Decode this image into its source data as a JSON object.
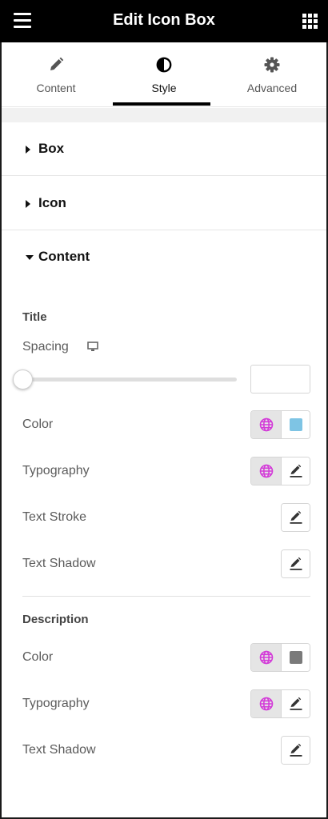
{
  "header": {
    "title": "Edit Icon Box",
    "menu_icon": "hamburger-icon",
    "apps_icon": "grid-icon"
  },
  "tabs": [
    {
      "label": "Content",
      "icon": "pencil-icon",
      "active": false
    },
    {
      "label": "Style",
      "icon": "contrast-icon",
      "active": true
    },
    {
      "label": "Advanced",
      "icon": "gear-icon",
      "active": false
    }
  ],
  "sections": {
    "box": {
      "title": "Box",
      "expanded": false
    },
    "icon": {
      "title": "Icon",
      "expanded": false
    },
    "content": {
      "title": "Content",
      "expanded": true
    }
  },
  "title_group": {
    "heading": "Title",
    "spacing": {
      "label": "Spacing",
      "value": "",
      "device_icon": "desktop-icon",
      "slider_level": 0
    },
    "color": {
      "label": "Color",
      "swatch": "#7ec4e4",
      "global_icon": "globe-icon"
    },
    "typography": {
      "label": "Typography",
      "global_icon": "globe-icon",
      "edit_icon": "pencil-icon"
    },
    "text_stroke": {
      "label": "Text Stroke",
      "edit_icon": "pencil-icon"
    },
    "text_shadow": {
      "label": "Text Shadow",
      "edit_icon": "pencil-icon"
    }
  },
  "description_group": {
    "heading": "Description",
    "color": {
      "label": "Color",
      "swatch": "#7a7a7a",
      "global_icon": "globe-icon"
    },
    "typography": {
      "label": "Typography",
      "global_icon": "globe-icon",
      "edit_icon": "pencil-icon"
    },
    "text_shadow": {
      "label": "Text Shadow",
      "edit_icon": "pencil-icon"
    }
  },
  "colors": {
    "accent_global": "#d33bd8",
    "topbar": "#000000"
  }
}
